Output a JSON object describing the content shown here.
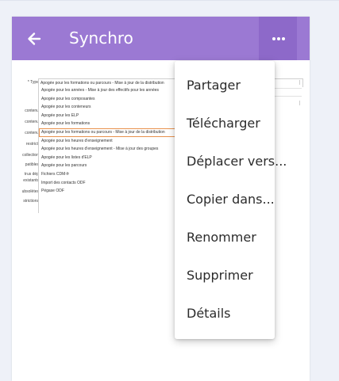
{
  "header": {
    "title": "Synchro",
    "back_icon": "arrow-left-icon",
    "more_icon": "more-horizontal-icon",
    "accent_color": "#9b79d3"
  },
  "preview": {
    "field_label": "* Type",
    "field_value": "Apogée pour les formations ou parcours - Mise à jour de la distribution",
    "side_labels": [
      "contenu",
      "contenu",
      "contenu",
      "restricti",
      "collection",
      "patibles",
      "trus dép",
      "existants",
      "ubsolètes",
      "strictions"
    ],
    "options": [
      "Apogée pour les années - Mise à jour des effectifs pour les années",
      "Apogée pour les composantes",
      "Apogée pour les conteneurs",
      "Apogée pour les ELP",
      "Apogée pour les formations",
      "Apogée pour les formations ou parcours - Mise à jour de la distribution",
      "Apogée pour les heures d'enseignement",
      "Apogée pour les heures d'enseignement - Mise à jour des groupes",
      "Apogée pour les listes d'ELP",
      "Apogée pour les parcours",
      "Fichiers CDM-fr",
      "Import des contacts ODF",
      "Pégase ODF"
    ],
    "selected_index": 5,
    "selected_color": "#e8914d"
  },
  "menu": {
    "items": [
      "Partager",
      "Télécharger",
      "Déplacer vers...",
      "Copier dans...",
      "Renommer",
      "Supprimer",
      "Détails"
    ]
  }
}
